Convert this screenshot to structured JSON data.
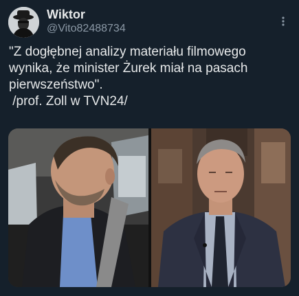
{
  "author": {
    "name": "Wiktor",
    "handle": "@Vito82488734"
  },
  "tweet": {
    "lines": [
      "\"Z dogłębnej analizy materiału filmowego",
      "wynika, że minister Żurek miał na pasach",
      "pierwszeństwo\".",
      " /prof. Zoll w TVN24/"
    ]
  },
  "icons": {
    "more": "more-options-icon"
  },
  "colors": {
    "background": "#15202b",
    "text": "#e7e9ea",
    "secondary_text": "#8b98a5"
  }
}
